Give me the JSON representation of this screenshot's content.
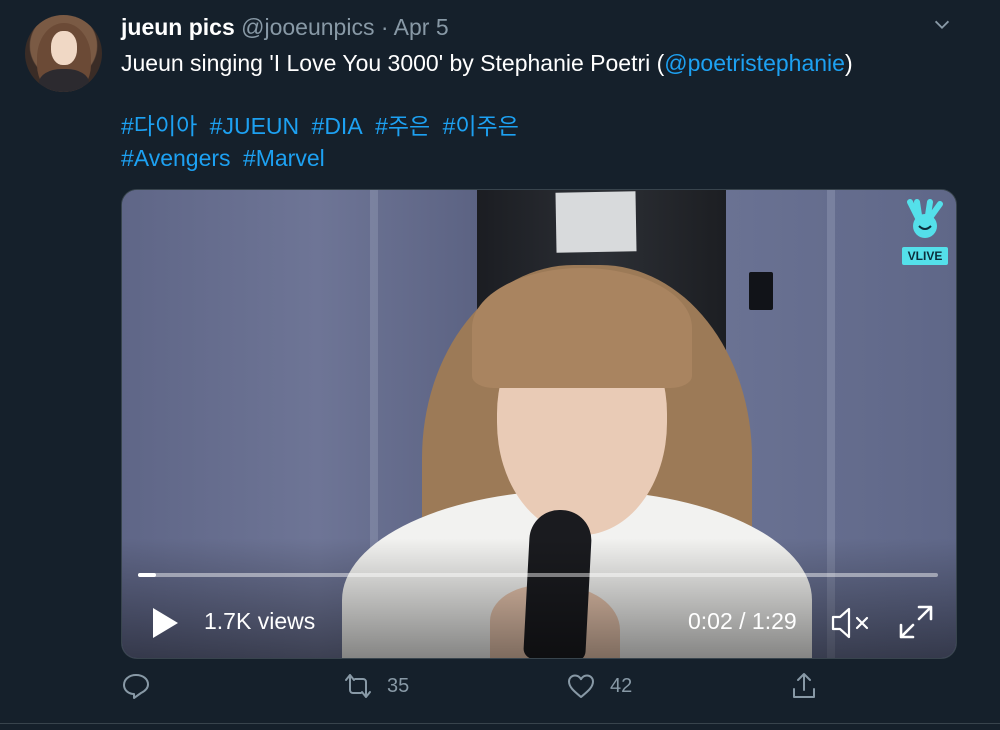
{
  "tweet": {
    "author_name": "jueun pics",
    "author_handle": "@jooeunpics",
    "separator": "·",
    "date": "Apr 5",
    "text_before_link": "Jueun singing 'I Love You 3000' by Stephanie Poetri (",
    "mention": "@poetristephanie",
    "text_after_link": ")",
    "hashtags_line1": [
      "#다이아",
      "#JUEUN",
      "#DIA",
      "#주은",
      "#이주은"
    ],
    "hashtags_line2": [
      "#Avengers",
      "#Marvel"
    ]
  },
  "video": {
    "views": "1.7K views",
    "time": "0:02 / 1:29",
    "badge": "VLIVE",
    "progress": 0.022
  },
  "actions": {
    "reply_count": "",
    "retweet_count": "35",
    "like_count": "42"
  },
  "icons": [
    "chevron-down-icon",
    "play-icon",
    "mute-icon",
    "fullscreen-icon",
    "reply-icon",
    "retweet-icon",
    "like-icon",
    "share-icon",
    "vlive-logo-icon"
  ],
  "colors": {
    "background": "#15202b",
    "link": "#1da1f2",
    "muted": "#8899a6"
  }
}
